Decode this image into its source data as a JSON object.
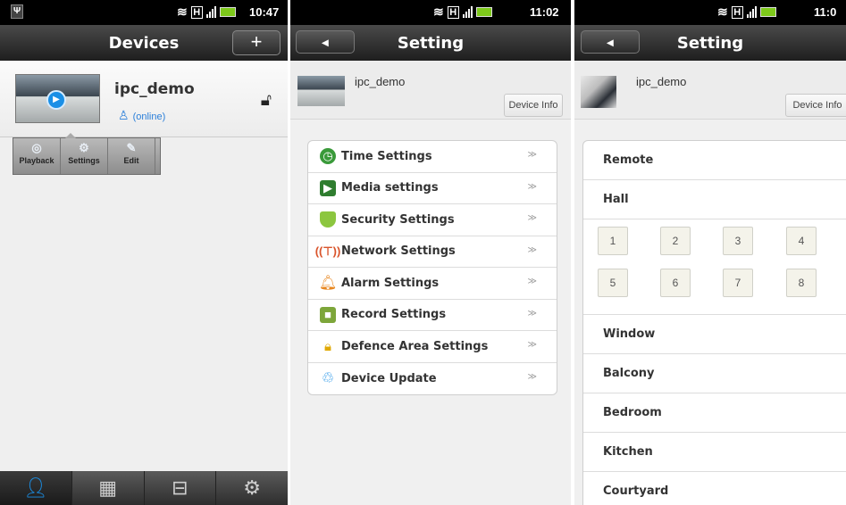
{
  "panel1": {
    "status_time": "10:47",
    "title": "Devices",
    "add_label": "+",
    "device": {
      "name": "ipc_demo",
      "status": "(online)"
    },
    "actions": [
      {
        "label": "Playback",
        "icon": "playback-icon"
      },
      {
        "label": "Settings",
        "icon": "settings-icon"
      },
      {
        "label": "Edit",
        "icon": "edit-icon"
      }
    ],
    "nav": [
      {
        "icon": "person-icon",
        "active": true
      },
      {
        "icon": "grid-icon"
      },
      {
        "icon": "toolbox-icon"
      },
      {
        "icon": "gear-icon"
      }
    ]
  },
  "panel2": {
    "status_time": "11:02",
    "title": "Setting",
    "device_name": "ipc_demo",
    "device_info_label": "Device Info",
    "settings": [
      {
        "label": "Time Settings",
        "icon": "clock-icon"
      },
      {
        "label": "Media settings",
        "icon": "media-icon"
      },
      {
        "label": "Security Settings",
        "icon": "shield-icon"
      },
      {
        "label": "Network Settings",
        "icon": "antenna-icon"
      },
      {
        "label": "Alarm Settings",
        "icon": "bell-icon"
      },
      {
        "label": "Record Settings",
        "icon": "record-icon"
      },
      {
        "label": "Defence Area Settings",
        "icon": "lock-icon"
      },
      {
        "label": "Device Update",
        "icon": "update-icon"
      }
    ],
    "arrow": "≫"
  },
  "panel3": {
    "status_time": "11:0",
    "title": "Setting",
    "device_name": "ipc_demo",
    "device_info_label": "Device Info",
    "rooms_top": [
      "Remote",
      "Hall"
    ],
    "numbers": [
      "1",
      "2",
      "3",
      "4",
      "5",
      "6",
      "7",
      "8"
    ],
    "rooms_bottom": [
      "Window",
      "Balcony",
      "Bedroom",
      "Kitchen",
      "Courtyard"
    ]
  },
  "colors": {
    "accent": "#1a8fe6",
    "battery": "#7ec91b",
    "titlebar": "#2a2a2a"
  }
}
